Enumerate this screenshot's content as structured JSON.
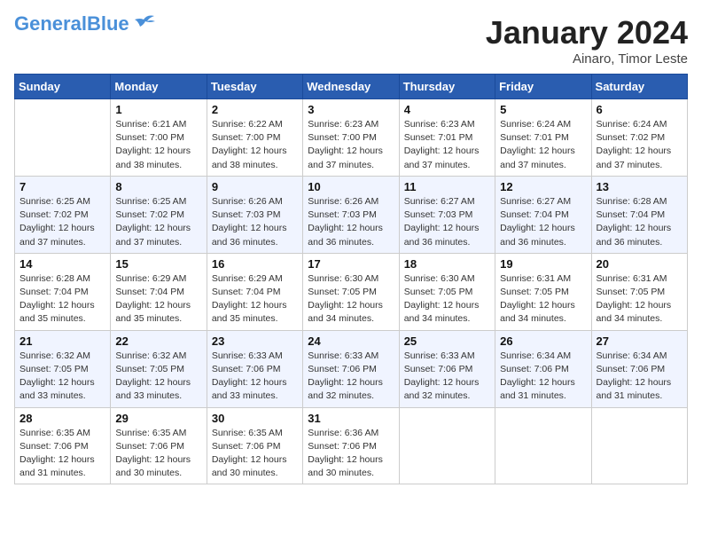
{
  "header": {
    "logo_general": "General",
    "logo_blue": "Blue",
    "month_title": "January 2024",
    "location": "Ainaro, Timor Leste"
  },
  "days_of_week": [
    "Sunday",
    "Monday",
    "Tuesday",
    "Wednesday",
    "Thursday",
    "Friday",
    "Saturday"
  ],
  "weeks": [
    [
      {
        "day": "",
        "info": ""
      },
      {
        "day": "1",
        "info": "Sunrise: 6:21 AM\nSunset: 7:00 PM\nDaylight: 12 hours\nand 38 minutes."
      },
      {
        "day": "2",
        "info": "Sunrise: 6:22 AM\nSunset: 7:00 PM\nDaylight: 12 hours\nand 38 minutes."
      },
      {
        "day": "3",
        "info": "Sunrise: 6:23 AM\nSunset: 7:00 PM\nDaylight: 12 hours\nand 37 minutes."
      },
      {
        "day": "4",
        "info": "Sunrise: 6:23 AM\nSunset: 7:01 PM\nDaylight: 12 hours\nand 37 minutes."
      },
      {
        "day": "5",
        "info": "Sunrise: 6:24 AM\nSunset: 7:01 PM\nDaylight: 12 hours\nand 37 minutes."
      },
      {
        "day": "6",
        "info": "Sunrise: 6:24 AM\nSunset: 7:02 PM\nDaylight: 12 hours\nand 37 minutes."
      }
    ],
    [
      {
        "day": "7",
        "info": "Sunrise: 6:25 AM\nSunset: 7:02 PM\nDaylight: 12 hours\nand 37 minutes."
      },
      {
        "day": "8",
        "info": "Sunrise: 6:25 AM\nSunset: 7:02 PM\nDaylight: 12 hours\nand 37 minutes."
      },
      {
        "day": "9",
        "info": "Sunrise: 6:26 AM\nSunset: 7:03 PM\nDaylight: 12 hours\nand 36 minutes."
      },
      {
        "day": "10",
        "info": "Sunrise: 6:26 AM\nSunset: 7:03 PM\nDaylight: 12 hours\nand 36 minutes."
      },
      {
        "day": "11",
        "info": "Sunrise: 6:27 AM\nSunset: 7:03 PM\nDaylight: 12 hours\nand 36 minutes."
      },
      {
        "day": "12",
        "info": "Sunrise: 6:27 AM\nSunset: 7:04 PM\nDaylight: 12 hours\nand 36 minutes."
      },
      {
        "day": "13",
        "info": "Sunrise: 6:28 AM\nSunset: 7:04 PM\nDaylight: 12 hours\nand 36 minutes."
      }
    ],
    [
      {
        "day": "14",
        "info": "Sunrise: 6:28 AM\nSunset: 7:04 PM\nDaylight: 12 hours\nand 35 minutes."
      },
      {
        "day": "15",
        "info": "Sunrise: 6:29 AM\nSunset: 7:04 PM\nDaylight: 12 hours\nand 35 minutes."
      },
      {
        "day": "16",
        "info": "Sunrise: 6:29 AM\nSunset: 7:04 PM\nDaylight: 12 hours\nand 35 minutes."
      },
      {
        "day": "17",
        "info": "Sunrise: 6:30 AM\nSunset: 7:05 PM\nDaylight: 12 hours\nand 34 minutes."
      },
      {
        "day": "18",
        "info": "Sunrise: 6:30 AM\nSunset: 7:05 PM\nDaylight: 12 hours\nand 34 minutes."
      },
      {
        "day": "19",
        "info": "Sunrise: 6:31 AM\nSunset: 7:05 PM\nDaylight: 12 hours\nand 34 minutes."
      },
      {
        "day": "20",
        "info": "Sunrise: 6:31 AM\nSunset: 7:05 PM\nDaylight: 12 hours\nand 34 minutes."
      }
    ],
    [
      {
        "day": "21",
        "info": "Sunrise: 6:32 AM\nSunset: 7:05 PM\nDaylight: 12 hours\nand 33 minutes."
      },
      {
        "day": "22",
        "info": "Sunrise: 6:32 AM\nSunset: 7:05 PM\nDaylight: 12 hours\nand 33 minutes."
      },
      {
        "day": "23",
        "info": "Sunrise: 6:33 AM\nSunset: 7:06 PM\nDaylight: 12 hours\nand 33 minutes."
      },
      {
        "day": "24",
        "info": "Sunrise: 6:33 AM\nSunset: 7:06 PM\nDaylight: 12 hours\nand 32 minutes."
      },
      {
        "day": "25",
        "info": "Sunrise: 6:33 AM\nSunset: 7:06 PM\nDaylight: 12 hours\nand 32 minutes."
      },
      {
        "day": "26",
        "info": "Sunrise: 6:34 AM\nSunset: 7:06 PM\nDaylight: 12 hours\nand 31 minutes."
      },
      {
        "day": "27",
        "info": "Sunrise: 6:34 AM\nSunset: 7:06 PM\nDaylight: 12 hours\nand 31 minutes."
      }
    ],
    [
      {
        "day": "28",
        "info": "Sunrise: 6:35 AM\nSunset: 7:06 PM\nDaylight: 12 hours\nand 31 minutes."
      },
      {
        "day": "29",
        "info": "Sunrise: 6:35 AM\nSunset: 7:06 PM\nDaylight: 12 hours\nand 30 minutes."
      },
      {
        "day": "30",
        "info": "Sunrise: 6:35 AM\nSunset: 7:06 PM\nDaylight: 12 hours\nand 30 minutes."
      },
      {
        "day": "31",
        "info": "Sunrise: 6:36 AM\nSunset: 7:06 PM\nDaylight: 12 hours\nand 30 minutes."
      },
      {
        "day": "",
        "info": ""
      },
      {
        "day": "",
        "info": ""
      },
      {
        "day": "",
        "info": ""
      }
    ]
  ]
}
